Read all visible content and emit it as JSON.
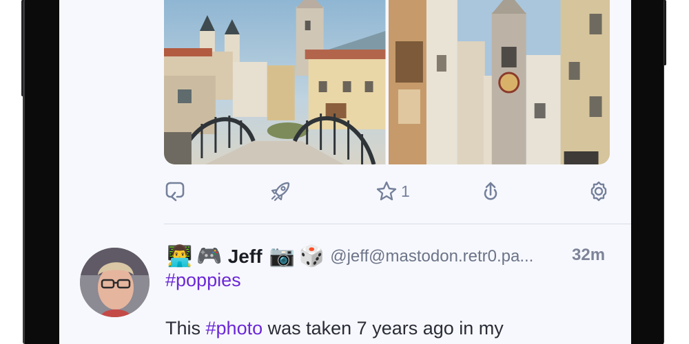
{
  "theme": {
    "accent": "#6b28d6",
    "icon_color": "#74809b",
    "background": "#f7f8fd"
  },
  "media": {
    "photos": [
      {
        "icon": "bridge-town-photo"
      },
      {
        "icon": "clock-tower-street-photo"
      }
    ]
  },
  "actions": {
    "reply_icon": "reply-icon",
    "boost_icon": "rocket-icon",
    "favourite_icon": "star-icon",
    "favourite_count": "1",
    "share_icon": "share-icon",
    "more_icon": "gear-icon"
  },
  "status": {
    "avatar_icon": "avatar-photo",
    "emoji_prefix": [
      "👨‍💻",
      "🎮"
    ],
    "display_name": "Jeff",
    "emoji_suffix": [
      "📷",
      "🎲"
    ],
    "handle": "@jeff@mastodon.retr0.pa...",
    "timestamp": "32m",
    "hashtag": "#poppies",
    "body_before": "This ",
    "body_link": "#photo",
    "body_after": " was taken 7 years ago in my"
  }
}
